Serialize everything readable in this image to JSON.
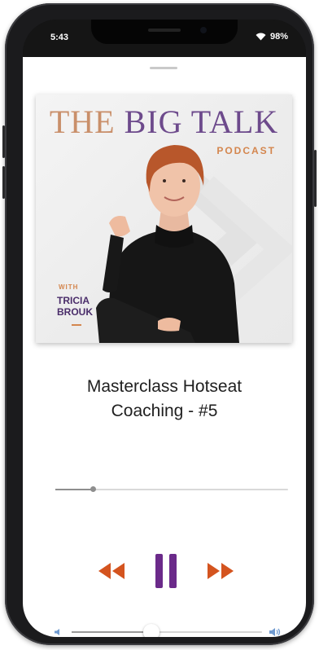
{
  "status_bar": {
    "time": "5:43",
    "battery": "98%"
  },
  "podcast": {
    "title_part1": "THE",
    "title_part2": " BIG TALK",
    "subtitle": "PODCAST",
    "with_label": "WITH",
    "host_first": "TRICIA",
    "host_last": "BROUK"
  },
  "track": {
    "title_line1": "Masterclass Hotseat",
    "title_line2": "Coaching - #5",
    "progress": 0.16
  },
  "volume": {
    "level": 0.42
  },
  "icons": {
    "wifi": "wifi-icon",
    "rewind": "rewind-icon",
    "pause": "pause-icon",
    "forward": "fast-forward-icon",
    "volume_low": "volume-low-icon",
    "volume_high": "volume-high-icon"
  },
  "colors": {
    "accent_orange": "#d4541f",
    "accent_purple": "#6b2a8a"
  }
}
